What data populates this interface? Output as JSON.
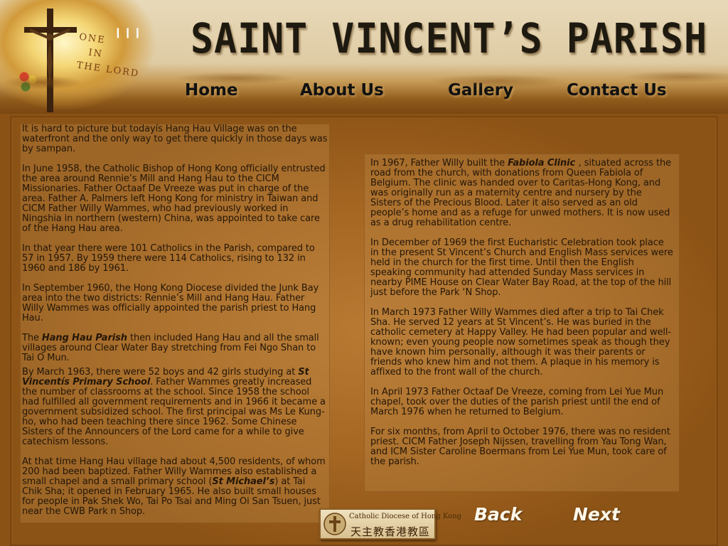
{
  "header": {
    "logo_text": [
      "ONE",
      "IN",
      "THE LORD"
    ],
    "site_title": "SAINT VINCENT’S PARISH"
  },
  "nav": {
    "home": "Home",
    "about": "About Us",
    "gallery": "Gallery",
    "contact": "Contact Us"
  },
  "left_column": [
    "It is hard to picture but todayís Hang Hau Village was on the waterfront and the only way to get there quickly in those days was by sampan.",
    "In June 1958, the Catholic Bishop of Hong Kong officially entrusted the area around Rennie’s Mill and Hang Hau to the CICM Missionaries. Father Octaaf De Vreeze was put in charge of the area. Father A. Palmers left Hong Kong for ministry in Taiwan and CICM Father Willy Wammes, who had previously worked in Ningshia in northern (western) China, was appointed to take care of the Hang Hau area.",
    "In that year there were 101 Catholics in the Parish, compared to 57 in 1957. By 1959 there were 114 Catholics, rising to 132 in 1960 and 186 by 1961.",
    "In September 1960, the Hong Kong Diocese divided the Junk Bay area into the two districts: Rennie’s Mill and Hang Hau. Father Willy Wammes was officially appointed the parish priest to Hang Hau."
  ],
  "hang_hau_para": {
    "before": "The ",
    "emph": "Hang Hau Parish",
    "after": " then included Hang Hau and all the small villages around Clear Water Bay stretching from Fei Ngo Shan to Tai O Mun."
  },
  "school_para": {
    "before": "By March 1963, there were 52 boys and 42 girls studying at ",
    "emph": "St Vincentís Primary School",
    "after": ". Father Wammes greatly increased the number of classrooms at the school. Since 1958 the school had fulfilled all government requirements and in 1966 it became a government subsidized school. The first principal was Ms Le Kung- ho, who had been teaching there since 1962. Some Chinese Sisters of the Announcers of the Lord came for a while to give catechism lessons."
  },
  "chapel_para": {
    "before": "At that time Hang Hau village had about 4,500 residents, of whom 200 had been baptized. Father Willy Wammes also established a small chapel and a small primary school (",
    "emph": "St Michael’s",
    "after": ") at Tai Chik Sha; it opened in February 1965. He also built small houses for people in Pak Shek Wo, Tai Po Tsai and Ming Oi San Tsuen, just near the CWB Park n Shop."
  },
  "clinic_para": {
    "before": "In 1967, Father Willy built the ",
    "emph": "Fabiola Clinic ",
    "after": ", situated across the road from the church, with donations from Queen Fabiola of Belgium. The clinic was handed over to Caritas-Hong Kong, and was originally run as a maternity centre and nursery by the Sisters of the Precious Blood. Later it also served as an old people’s home and as a refuge for unwed mothers. It is now used as a drug rehabilitation centre."
  },
  "right_column": [
    "In December of 1969 the first Eucharistic Celebration took place in the present St Vincent’s Church and English Mass services were held in the church for the first time. Until then the English speaking community had attended Sunday Mass services in nearby PIME House on Clear Water Bay Road, at the top of the hill just before the Park ‘N Shop.",
    "In March 1973 Father Willy Wammes died after a trip to Tai Chek Sha. He served 12 years at St Vincent’s. He was buried in the catholic cemetery at Happy Valley. He had been popular and well-known; even young people now sometimes speak as though they have known him personally, although it was their parents or friends who knew him and not them. A plaque in his memory is affixed to the front wall of the church.",
    "In April 1973 Father Octaaf De Vreeze, coming from Lei Yue Mun chapel, took over the duties of the parish priest until the end of March 1976 when he returned to Belgium.",
    "For six months, from April to October 1976, there was no resident priest. CICM Father Joseph Nijssen, travelling from Yau Tong Wan, and ICM Sister Caroline Boermans from Lei Yue Mun, took care of the parish."
  ],
  "footer": {
    "diocese_en": "Catholic Diocese of Hong Kong",
    "diocese_zh": "天主教香港教區",
    "back": "Back",
    "next": "Next"
  },
  "icons": [
    "crucifix-icon",
    "diocese-emblem-icon"
  ]
}
